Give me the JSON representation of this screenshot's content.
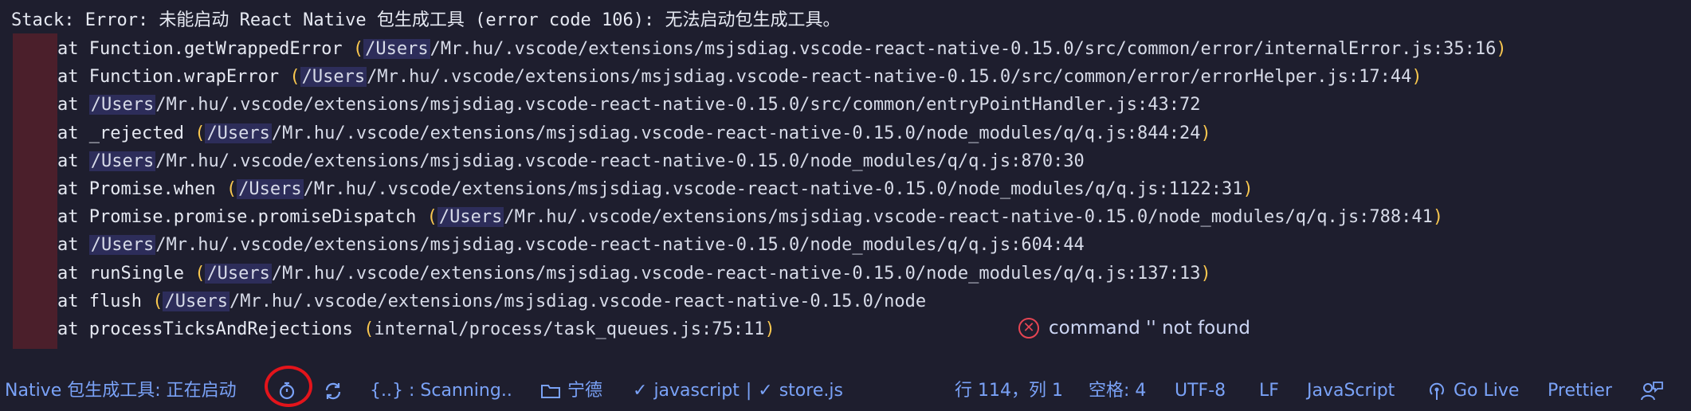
{
  "terminal": {
    "header": "Stack: Error: 未能启动 React Native 包生成工具 (error code 106): 无法启动包生成工具。",
    "frames": [
      {
        "prefix": "at Function.getWrappedError ",
        "open": "(",
        "user": "/Users",
        "rest": "/Mr.hu/.vscode/extensions/msjsdiag.vscode-react-native-0.15.0/src/common/error/internalError.js:35:16",
        "close": ")"
      },
      {
        "prefix": "at Function.wrapError ",
        "open": "(",
        "user": "/Users",
        "rest": "/Mr.hu/.vscode/extensions/msjsdiag.vscode-react-native-0.15.0/src/common/error/errorHelper.js:17:44",
        "close": ")"
      },
      {
        "prefix": "at ",
        "open": "",
        "user": "/Users",
        "rest": "/Mr.hu/.vscode/extensions/msjsdiag.vscode-react-native-0.15.0/src/common/entryPointHandler.js:43:72",
        "close": ""
      },
      {
        "prefix": "at _rejected ",
        "open": "(",
        "user": "/Users",
        "rest": "/Mr.hu/.vscode/extensions/msjsdiag.vscode-react-native-0.15.0/node_modules/q/q.js:844:24",
        "close": ")"
      },
      {
        "prefix": "at ",
        "open": "",
        "user": "/Users",
        "rest": "/Mr.hu/.vscode/extensions/msjsdiag.vscode-react-native-0.15.0/node_modules/q/q.js:870:30",
        "close": ""
      },
      {
        "prefix": "at Promise.when ",
        "open": "(",
        "user": "/Users",
        "rest": "/Mr.hu/.vscode/extensions/msjsdiag.vscode-react-native-0.15.0/node_modules/q/q.js:1122:31",
        "close": ")"
      },
      {
        "prefix": "at Promise.promise.promiseDispatch ",
        "open": "(",
        "user": "/Users",
        "rest": "/Mr.hu/.vscode/extensions/msjsdiag.vscode-react-native-0.15.0/node_modules/q/q.js:788:41",
        "close": ")"
      },
      {
        "prefix": "at ",
        "open": "",
        "user": "/Users",
        "rest": "/Mr.hu/.vscode/extensions/msjsdiag.vscode-react-native-0.15.0/node_modules/q/q.js:604:44",
        "close": ""
      },
      {
        "prefix": "at runSingle ",
        "open": "(",
        "user": "/Users",
        "rest": "/Mr.hu/.vscode/extensions/msjsdiag.vscode-react-native-0.15.0/node_modules/q/q.js:137:13",
        "close": ")"
      },
      {
        "prefix": "at flush ",
        "open": "(",
        "user": "/Users",
        "rest": "/Mr.hu/.vscode/extensions/msjsdiag.vscode-react-native-0.15.0/node",
        "close": ""
      },
      {
        "prefix": "at processTicksAndRejections ",
        "open": "(",
        "user": "",
        "rest": "internal/process/task_queues.js:75:11",
        "close": ")"
      }
    ]
  },
  "notification": {
    "icon": "error-circle-icon",
    "message": "command '' not found"
  },
  "statusbar": {
    "packager_status": "Native 包生成工具: 正在启动",
    "scanning": "{..} : Scanning..",
    "folder": "宁德",
    "check1": "javascript",
    "separator": "|",
    "check2": "store.js",
    "position": "行 114，列 1",
    "spaces": "空格: 4",
    "encoding": "UTF-8",
    "eol": "LF",
    "language": "JavaScript",
    "golive": "Go Live",
    "prettier": "Prettier"
  },
  "colors": {
    "background": "#1e1e2e",
    "gutter": "#4b1f2b",
    "paren": "#f9c74f",
    "statusbar_text": "#7aa2f7",
    "error": "#e64553",
    "highlight_ring": "#e3141b"
  }
}
